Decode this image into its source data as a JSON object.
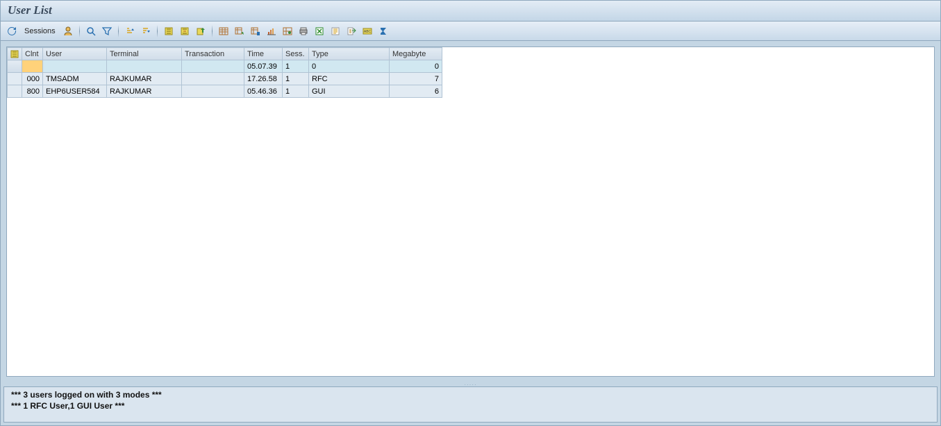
{
  "title": "User List",
  "toolbar": {
    "sessions_label": "Sessions"
  },
  "columns": {
    "selector": "",
    "clnt": "Clnt",
    "user": "User",
    "terminal": "Terminal",
    "transaction": "Transaction",
    "time": "Time",
    "sess": "Sess.",
    "type": "Type",
    "mb": "Megabyte"
  },
  "rows": [
    {
      "clnt": "",
      "user": "",
      "terminal": "",
      "transaction": "",
      "time": "05.07.39",
      "sess": "1",
      "type": "0",
      "mb": "0",
      "selected": true
    },
    {
      "clnt": "000",
      "user": "TMSADM",
      "terminal": "RAJKUMAR",
      "transaction": "",
      "time": "17.26.58",
      "sess": "1",
      "type": "RFC",
      "mb": "7",
      "selected": false
    },
    {
      "clnt": "800",
      "user": "EHP6USER584",
      "terminal": "RAJKUMAR",
      "transaction": "",
      "time": "05.46.36",
      "sess": "1",
      "type": "GUI",
      "mb": "6",
      "selected": false
    }
  ],
  "status": {
    "line1": "*** 3 users logged on with 3 modes ***",
    "line2": "*** 1 RFC User,1 GUI User ***"
  }
}
